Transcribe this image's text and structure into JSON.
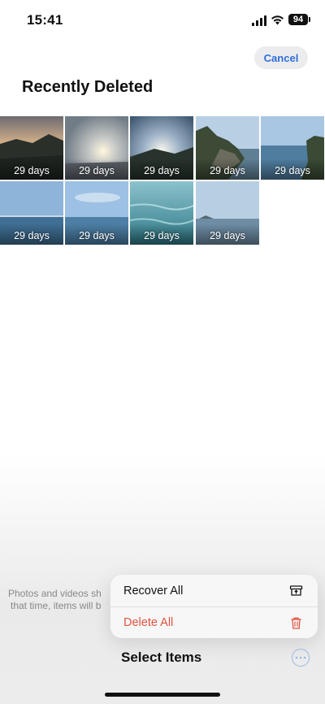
{
  "status_bar": {
    "time": "15:41",
    "battery": "94"
  },
  "header": {
    "cancel_label": "Cancel",
    "title": "Recently Deleted"
  },
  "photos": [
    {
      "label": "29 days",
      "scene": "sunset-mountain"
    },
    {
      "label": "29 days",
      "scene": "sun-rays-clouds"
    },
    {
      "label": "29 days",
      "scene": "sunbeams-hill"
    },
    {
      "label": "29 days",
      "scene": "rocky-coast"
    },
    {
      "label": "29 days",
      "scene": "sea-cliff"
    },
    {
      "label": "29 days",
      "scene": "blue-sea-horizon"
    },
    {
      "label": "29 days",
      "scene": "sky-sea"
    },
    {
      "label": "29 days",
      "scene": "ocean-waves"
    },
    {
      "label": "29 days",
      "scene": "calm-sea-island"
    }
  ],
  "footer": {
    "line1": "Photos and videos sh",
    "line2": "that time, items will b"
  },
  "menu": {
    "recover_label": "Recover All",
    "delete_label": "Delete All"
  },
  "toolbar": {
    "select_label": "Select Items"
  },
  "colors": {
    "accent": "#2f6fd9",
    "destructive": "#e0533f"
  }
}
